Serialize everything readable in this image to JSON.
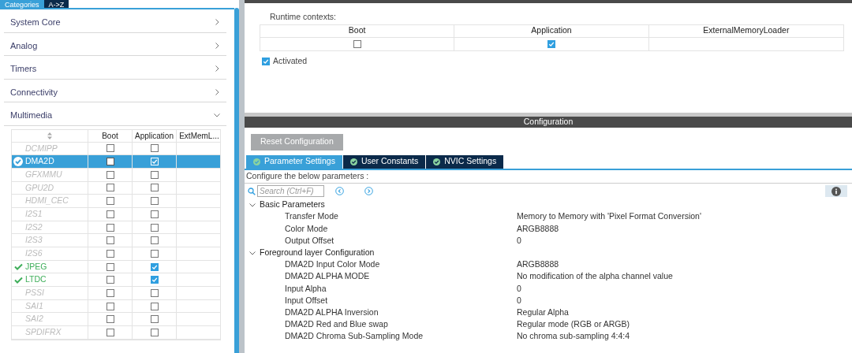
{
  "sidebar": {
    "tabs": [
      {
        "label": "Categories",
        "selected": true
      },
      {
        "label": "A->Z",
        "selected": false
      }
    ],
    "categories": [
      {
        "label": "System Core",
        "expanded": false
      },
      {
        "label": "Analog",
        "expanded": false
      },
      {
        "label": "Timers",
        "expanded": false
      },
      {
        "label": "Connectivity",
        "expanded": false
      },
      {
        "label": "Multimedia",
        "expanded": true
      }
    ],
    "peripheral_table": {
      "columns": [
        "Boot",
        "Application",
        "ExtMemL..."
      ],
      "rows": [
        {
          "name": "DCMIPP",
          "configured": false,
          "selected": false,
          "boot": false,
          "application": false
        },
        {
          "name": "DMA2D",
          "configured": true,
          "selected": true,
          "boot": false,
          "application": true
        },
        {
          "name": "GFXMMU",
          "configured": false,
          "selected": false,
          "boot": false,
          "application": false
        },
        {
          "name": "GPU2D",
          "configured": false,
          "selected": false,
          "boot": false,
          "application": false
        },
        {
          "name": "HDMI_CEC",
          "configured": false,
          "selected": false,
          "boot": false,
          "application": false
        },
        {
          "name": "I2S1",
          "configured": false,
          "selected": false,
          "boot": false,
          "application": false
        },
        {
          "name": "I2S2",
          "configured": false,
          "selected": false,
          "boot": false,
          "application": false
        },
        {
          "name": "I2S3",
          "configured": false,
          "selected": false,
          "boot": false,
          "application": false
        },
        {
          "name": "I2S6",
          "configured": false,
          "selected": false,
          "boot": false,
          "application": false
        },
        {
          "name": "JPEG",
          "configured": true,
          "selected": false,
          "boot": false,
          "application": true
        },
        {
          "name": "LTDC",
          "configured": true,
          "selected": false,
          "boot": false,
          "application": true
        },
        {
          "name": "PSSI",
          "configured": false,
          "selected": false,
          "boot": false,
          "application": false
        },
        {
          "name": "SAI1",
          "configured": false,
          "selected": false,
          "boot": false,
          "application": false
        },
        {
          "name": "SAI2",
          "configured": false,
          "selected": false,
          "boot": false,
          "application": false
        },
        {
          "name": "SPDIFRX",
          "configured": false,
          "selected": false,
          "boot": false,
          "application": false
        }
      ]
    }
  },
  "runtime_contexts": {
    "label": "Runtime contexts:",
    "contexts": [
      {
        "label": "Boot",
        "kind": "checkbox",
        "checked": false
      },
      {
        "label": "Application",
        "kind": "checkbox",
        "checked": true
      },
      {
        "label": "ExternalMemoryLoader",
        "kind": "empty"
      }
    ]
  },
  "activated": {
    "label": "Activated",
    "checked": true
  },
  "configuration": {
    "title": "Configuration",
    "reset_button": "Reset Configuration",
    "tabs": [
      {
        "label": "Parameter Settings",
        "selected": true
      },
      {
        "label": "User Constants",
        "selected": false
      },
      {
        "label": "NVIC Settings",
        "selected": false
      }
    ],
    "hint": "Configure the below parameters :",
    "search": {
      "placeholder": "Search (Ctrl+F)"
    },
    "groups": [
      {
        "label": "Basic Parameters",
        "expanded": true,
        "params": [
          {
            "name": "Transfer Mode",
            "value": "Memory to Memory with 'Pixel Format Conversion'"
          },
          {
            "name": "Color Mode",
            "value": "ARGB8888"
          },
          {
            "name": "Output Offset",
            "value": "0"
          }
        ]
      },
      {
        "label": "Foreground layer Configuration",
        "expanded": true,
        "params": [
          {
            "name": "DMA2D Input Color Mode",
            "value": "ARGB8888"
          },
          {
            "name": "DMA2D ALPHA MODE",
            "value": "No modification of the alpha channel value"
          },
          {
            "name": "Input Alpha",
            "value": "0"
          },
          {
            "name": "Input Offset",
            "value": "0"
          },
          {
            "name": "DMA2D ALPHA Inversion",
            "value": "Regular Alpha"
          },
          {
            "name": "DMA2D Red and Blue swap",
            "value": "Regular mode (RGB or ARGB)"
          },
          {
            "name": "DMA2D Chroma Sub-Sampling Mode",
            "value": "No chroma sub-sampling 4:4:4"
          }
        ]
      }
    ]
  }
}
